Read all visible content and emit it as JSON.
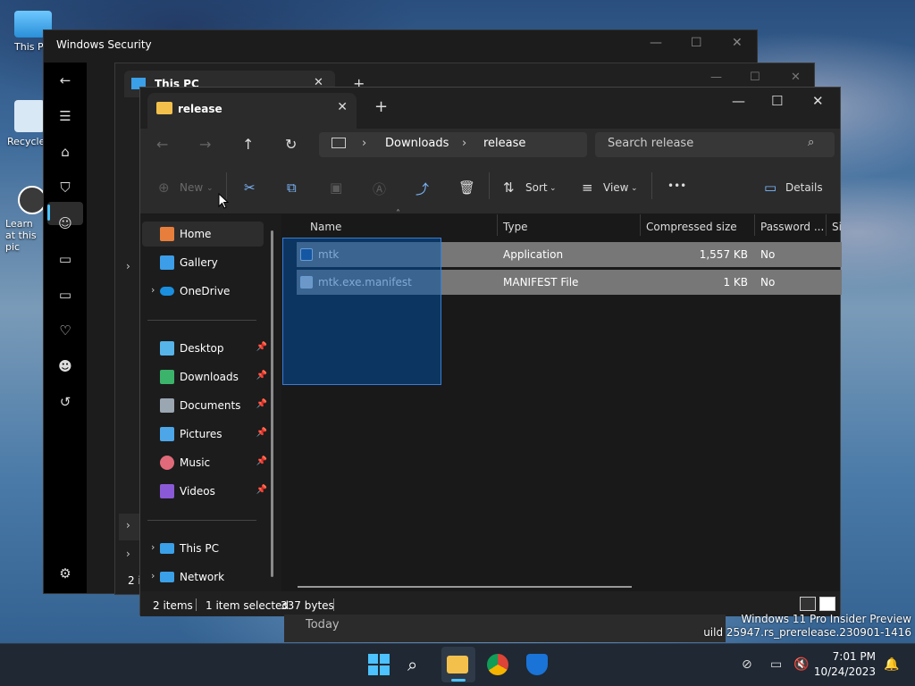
{
  "desktop": {
    "icons": [
      {
        "label": "This P"
      },
      {
        "label": "Recycle"
      },
      {
        "label": "Learn at this pic"
      }
    ]
  },
  "security_window": {
    "title": "Windows Security"
  },
  "this_pc_window": {
    "tab_label": "This PC",
    "partial_count": "2 i"
  },
  "explorer": {
    "tab_label": "release",
    "breadcrumbs": [
      "Downloads",
      "release"
    ],
    "search_placeholder": "Search release",
    "toolbar": {
      "new_label": "New",
      "sort_label": "Sort",
      "view_label": "View",
      "details_label": "Details",
      "more_label": "•••"
    },
    "nav_items": [
      {
        "label": "Home"
      },
      {
        "label": "Gallery"
      },
      {
        "label": "OneDrive"
      },
      {
        "label": "Desktop"
      },
      {
        "label": "Downloads"
      },
      {
        "label": "Documents"
      },
      {
        "label": "Pictures"
      },
      {
        "label": "Music"
      },
      {
        "label": "Videos"
      },
      {
        "label": "This PC"
      },
      {
        "label": "Network"
      }
    ],
    "columns": [
      "Name",
      "Type",
      "Compressed size",
      "Password ...",
      "Si"
    ],
    "files": [
      {
        "name": "mtk",
        "type": "Application",
        "size": "1,557 KB",
        "password": "No"
      },
      {
        "name": "mtk.exe.manifest",
        "type": "MANIFEST File",
        "size": "1 KB",
        "password": "No"
      }
    ],
    "status": {
      "items": "2 items",
      "selected": "1 item selected",
      "bytes": "337 bytes"
    }
  },
  "today_label": "Today",
  "watermark": {
    "line1": "Windows 11 Pro Insider Preview",
    "line2": "uild 25947.rs_prerelease.230901-1416"
  },
  "taskbar": {
    "time": "7:01 PM",
    "date": "10/24/2023"
  },
  "colors": {
    "accent": "#4cc2ff",
    "selection": "#0054aa",
    "row_selected": "#777777",
    "folder": "#f3c14b"
  }
}
